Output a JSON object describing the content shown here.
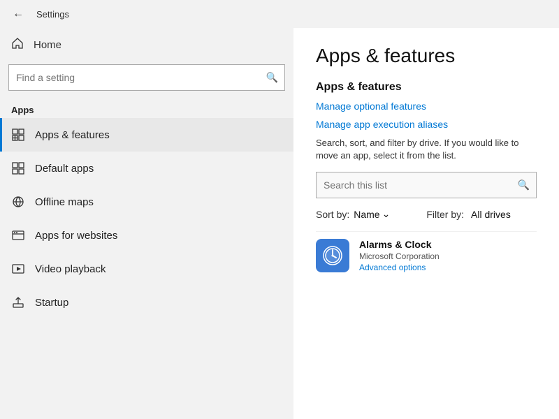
{
  "titleBar": {
    "title": "Settings"
  },
  "sidebar": {
    "home_label": "Home",
    "find_setting_placeholder": "Find a setting",
    "section_label": "Apps",
    "items": [
      {
        "id": "apps-features",
        "label": "Apps & features",
        "active": true
      },
      {
        "id": "default-apps",
        "label": "Default apps",
        "active": false
      },
      {
        "id": "offline-maps",
        "label": "Offline maps",
        "active": false
      },
      {
        "id": "apps-websites",
        "label": "Apps for websites",
        "active": false
      },
      {
        "id": "video-playback",
        "label": "Video playback",
        "active": false
      },
      {
        "id": "startup",
        "label": "Startup",
        "active": false
      }
    ]
  },
  "rightPanel": {
    "page_title": "Apps & features",
    "section_title": "Apps & features",
    "links": [
      {
        "id": "manage-optional",
        "label": "Manage optional features"
      },
      {
        "id": "manage-aliases",
        "label": "Manage app execution aliases"
      }
    ],
    "description": "Search, sort, and filter by drive. If you would like to move an app, select it from the list.",
    "search_list_placeholder": "Search this list",
    "sort_label": "Sort by:",
    "sort_value": "Name",
    "filter_label": "Filter by:",
    "filter_value": "All drives",
    "apps": [
      {
        "id": "alarms-clock",
        "name": "Alarms & Clock",
        "publisher": "Microsoft Corporation",
        "advanced_link": "Advanced options",
        "icon_emoji": "🕐",
        "icon_bg": "#3a7bd5"
      }
    ]
  }
}
